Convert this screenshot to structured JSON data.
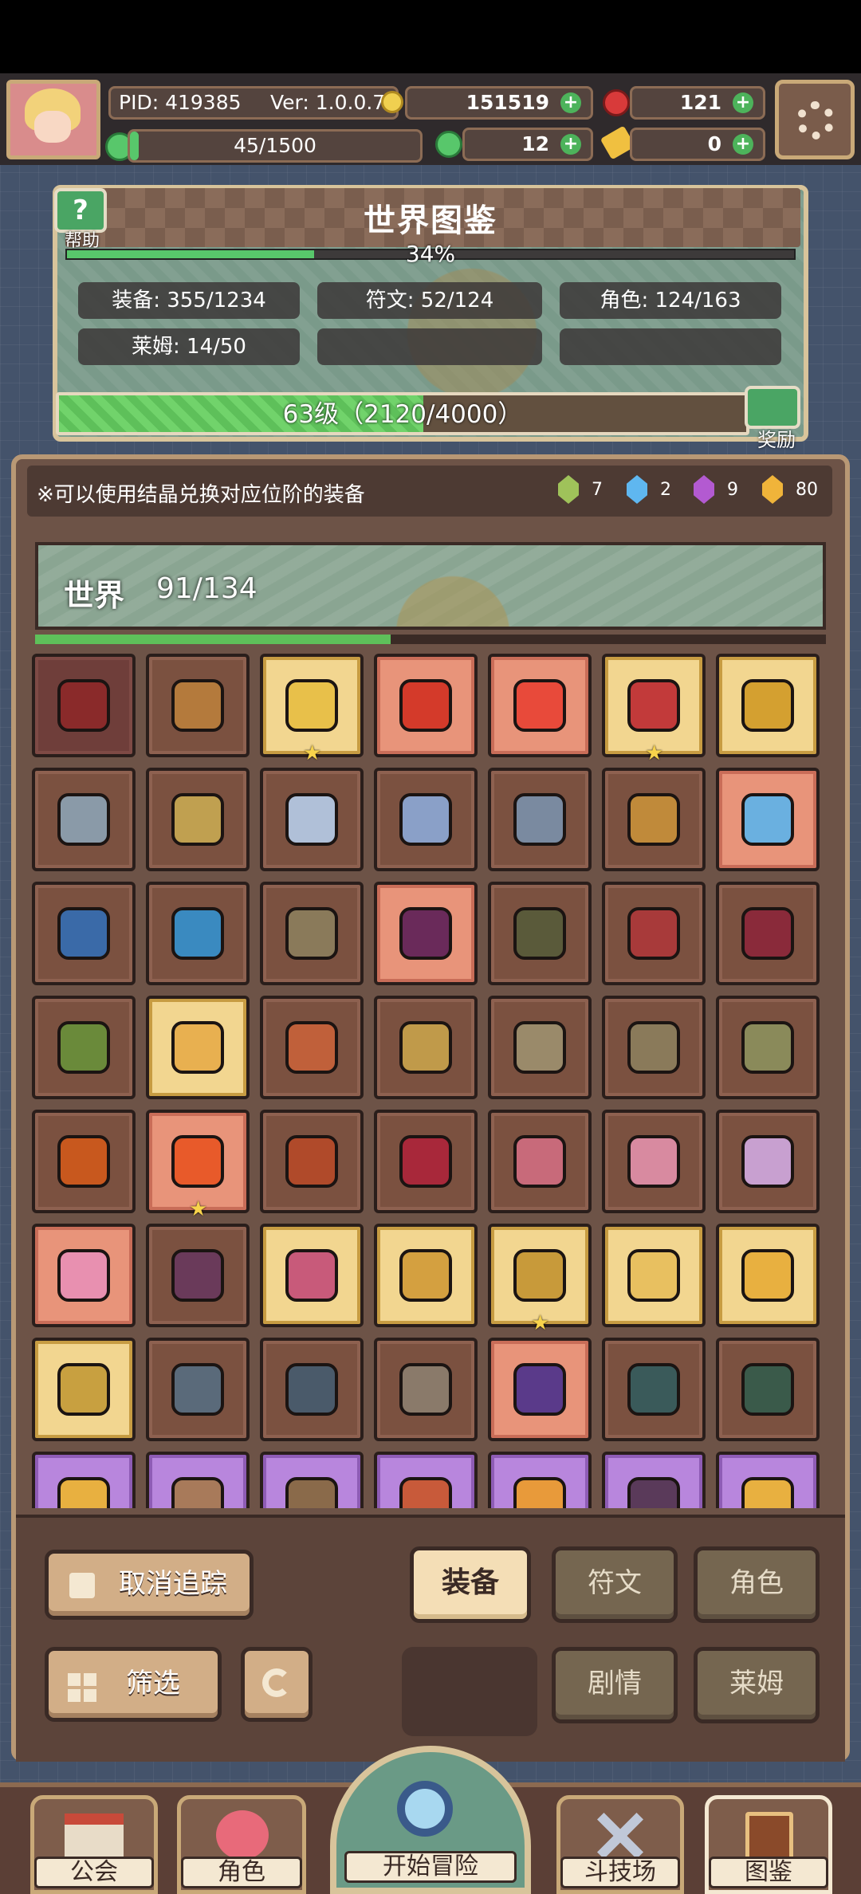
{
  "topbar": {
    "pid": "PID: 419385",
    "version": "Ver: 1.0.0.7",
    "gold": "151519",
    "gems": "121",
    "energy": "45/1500",
    "clover": "12",
    "keys": "0",
    "energy_fraction": 0.03
  },
  "world_panel": {
    "help_label": "帮助",
    "title": "世界图鉴",
    "percent": "34%",
    "percent_value": 0.34,
    "stats": [
      "装备: 355/1234",
      "符文: 52/124",
      "角色: 124/163",
      "莱姆: 14/50"
    ],
    "level": "63级（2120/4000）",
    "level_fraction": 0.53,
    "reward_label": "奖励"
  },
  "notice": {
    "text": "※可以使用结晶兑换对应位阶的装备",
    "crystals": [
      {
        "color": "#9fc25a",
        "count": "7"
      },
      {
        "color": "#5fb7f0",
        "count": "2"
      },
      {
        "color": "#b35ad1",
        "count": "9"
      },
      {
        "color": "#f0b43a",
        "count": "80"
      }
    ]
  },
  "world_section": {
    "label": "世界",
    "count": "91/134",
    "fraction": 0.45
  },
  "grid": {
    "rows": [
      [
        "maroon",
        "brown",
        "gold",
        "salmon",
        "salmon",
        "gold",
        "gold"
      ],
      [
        "brown",
        "brown",
        "brown",
        "brown",
        "brown",
        "brown",
        "salmon"
      ],
      [
        "brown",
        "brown",
        "brown",
        "salmon",
        "brown",
        "brown",
        "brown"
      ],
      [
        "brown",
        "gold",
        "brown",
        "brown",
        "brown",
        "brown",
        "brown"
      ],
      [
        "brown",
        "salmon",
        "brown",
        "brown",
        "brown",
        "brown",
        "brown"
      ],
      [
        "salmon",
        "brown",
        "gold",
        "gold",
        "gold",
        "gold",
        "gold"
      ],
      [
        "gold",
        "brown",
        "brown",
        "brown",
        "salmon",
        "brown",
        "brown"
      ],
      [
        "purple",
        "purple",
        "purple",
        "purple",
        "purple",
        "purple",
        "purple"
      ]
    ],
    "item_colors": [
      [
        "#8a2a2a",
        "#b47a3c",
        "#e8c04a",
        "#d43a2a",
        "#e84a3a",
        "#c23a3a",
        "#d4a030"
      ],
      [
        "#8a9aa8",
        "#c0a050",
        "#b0c0d8",
        "#8aa0c8",
        "#7a8aa0",
        "#c08a3a",
        "#6ab0e0"
      ],
      [
        "#3a6aa8",
        "#3a8ac0",
        "#8a7a5a",
        "#6a2a5a",
        "#5a5a3a",
        "#a83a3a",
        "#8a2a3a"
      ],
      [
        "#6a8a3a",
        "#e8b050",
        "#c0603a",
        "#c09a4a",
        "#9a8a6a",
        "#8a7a5a",
        "#8a8a5a"
      ],
      [
        "#c8581e",
        "#e85a2a",
        "#b04a2a",
        "#a8283a",
        "#c86a7a",
        "#d88aa0",
        "#c8a0d0"
      ],
      [
        "#e890b0",
        "#6a3a5a",
        "#c85a7a",
        "#d4a040",
        "#c89a3a",
        "#e8c060",
        "#e8b040"
      ],
      [
        "#c8a040",
        "#5a6a7a",
        "#4a5a6a",
        "#8a7a6a",
        "#5a3a8a",
        "#3a5a5a",
        "#3a5a4a"
      ],
      [
        "#e8b040",
        "#a87a5a",
        "#8a6a4a",
        "#c85a3a",
        "#e89a3a",
        "#5a3a5a",
        "#e8b040"
      ]
    ],
    "starred": [
      "0-2",
      "0-5",
      "4-1",
      "5-4"
    ]
  },
  "controls": {
    "untrack": "取消追踪",
    "filter": "筛选",
    "tab_equipment": "装备",
    "tab_rune": "符文",
    "tab_character": "角色",
    "tab_story": "剧情",
    "tab_slime": "莱姆"
  },
  "bottomnav": {
    "guild": "公会",
    "character": "角色",
    "start": "开始冒险",
    "arena": "斗技场",
    "codex": "图鉴"
  },
  "colors": {
    "accent_green": "#58c76b",
    "panel_brown": "#6d5347",
    "border_tan": "#b89875"
  }
}
